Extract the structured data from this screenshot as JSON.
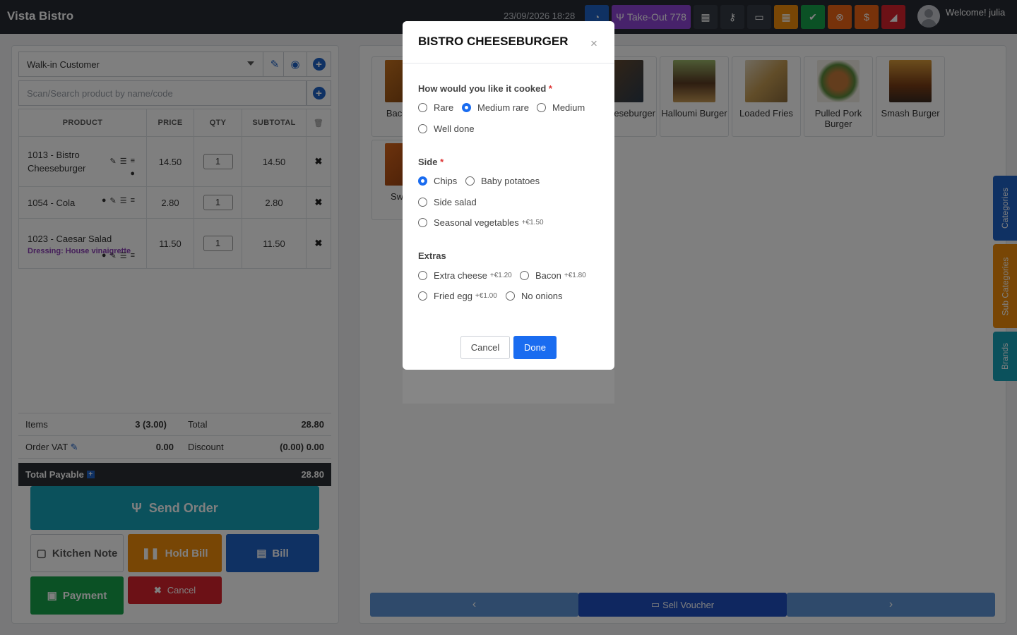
{
  "header": {
    "brand": "Vista Bistro",
    "datetime": "23/09/2026 18:28",
    "takeout_label": "Take-Out 778",
    "welcome": "Welcome! julia"
  },
  "left": {
    "customer": "Walk-in Customer",
    "search_placeholder": "Scan/Search product by name/code",
    "columns": [
      "PRODUCT",
      "PRICE",
      "QTY",
      "SUBTOTAL"
    ],
    "rows": [
      {
        "name": "1013 - Bistro Cheeseburger",
        "sub": "",
        "price": "14.50",
        "qty": "1",
        "subtotal": "14.50"
      },
      {
        "name": "1054 - Cola",
        "sub": "",
        "price": "2.80",
        "qty": "1",
        "subtotal": "2.80"
      },
      {
        "name": "1023 - Caesar Salad",
        "sub": "Dressing: House vinaigrette",
        "price": "11.50",
        "qty": "1",
        "subtotal": "11.50"
      }
    ],
    "totals": {
      "items_label": "Items",
      "items_value": "3 (3.00)",
      "total_label": "Total",
      "total_value": "28.80",
      "vat_label": "Order VAT",
      "vat_value": "0.00",
      "discount_label": "Discount",
      "discount_value": "(0.00) 0.00",
      "payable_label": "Total Payable",
      "payable_value": "28.80"
    },
    "buttons": {
      "send_order": "Send Order",
      "kitchen_note": "Kitchen Note",
      "hold_bill": "Hold Bill",
      "bill": "Bill",
      "payment": "Payment",
      "cancel": "Cancel"
    }
  },
  "products": [
    {
      "name": "Bacon Bu"
    },
    {
      "name": "ouble eseburger"
    },
    {
      "name": "Halloumi Burger"
    },
    {
      "name": "Loaded Fries"
    },
    {
      "name": "Pulled Pork Burger"
    },
    {
      "name": "Smash Burger"
    },
    {
      "name": "Swee F"
    }
  ],
  "right": {
    "sell_voucher": "Sell Voucher",
    "tabs": [
      "Categories",
      "Sub Categories",
      "Brands"
    ]
  },
  "modal": {
    "title": "BISTRO CHEESEBURGER",
    "cooked_title": "How would you like it cooked",
    "cooked_options": [
      "Rare",
      "Medium rare",
      "Medium",
      "Well done"
    ],
    "side_title": "Side",
    "side_options": [
      "Chips",
      "Baby potatoes",
      "Side salad",
      "Seasonal vegetables"
    ],
    "side_veg_price": "+€1.50",
    "extras_title": "Extras",
    "extras": [
      {
        "label": "Extra cheese",
        "price": "+€1.20"
      },
      {
        "label": "Bacon",
        "price": "+€1.80"
      },
      {
        "label": "Fried egg",
        "price": "+€1.00"
      },
      {
        "label": "No onions",
        "price": ""
      }
    ],
    "cancel": "Cancel",
    "done": "Done"
  },
  "colors": {
    "primary": "#1f63c7",
    "takeout": "#8e44d6",
    "teal": "#17a2b8",
    "orange": "#f08c0a",
    "green": "#17a34a",
    "red": "#d9232d",
    "dark": "#262a33"
  }
}
